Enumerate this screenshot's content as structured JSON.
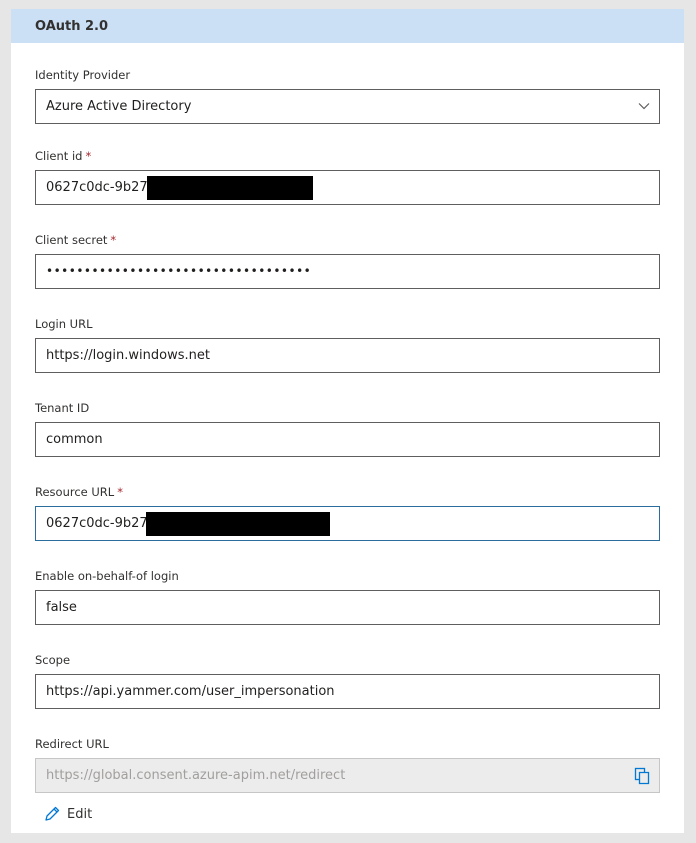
{
  "header": {
    "title": "OAuth 2.0"
  },
  "fields": {
    "identity_provider": {
      "label": "Identity Provider",
      "value": "Azure Active Directory"
    },
    "client_id": {
      "label": "Client id",
      "required_mark": "*",
      "value": "0627c0dc-9b27-"
    },
    "client_secret": {
      "label": "Client secret",
      "required_mark": "*",
      "value": "•••••••••••••••••••••••••••••••••••"
    },
    "login_url": {
      "label": "Login URL",
      "value": "https://login.windows.net"
    },
    "tenant_id": {
      "label": "Tenant ID",
      "value": "common"
    },
    "resource_url": {
      "label": "Resource URL",
      "required_mark": "*",
      "value": "0627c0dc-9b27-"
    },
    "on_behalf_login": {
      "label": "Enable on-behalf-of login",
      "value": "false"
    },
    "scope": {
      "label": "Scope",
      "value": "https://api.yammer.com/user_impersonation"
    },
    "redirect_url": {
      "label": "Redirect URL",
      "value": "https://global.consent.azure-apim.net/redirect"
    }
  },
  "actions": {
    "edit_label": "Edit"
  },
  "icons": {
    "dropdown": "chevron-down-icon",
    "copy": "copy-icon",
    "edit": "pencil-icon"
  },
  "colors": {
    "header_bg": "#cce0f5",
    "required": "#a4262c",
    "focus_border": "#2b6e9e",
    "accent_icon": "#0078d4"
  }
}
